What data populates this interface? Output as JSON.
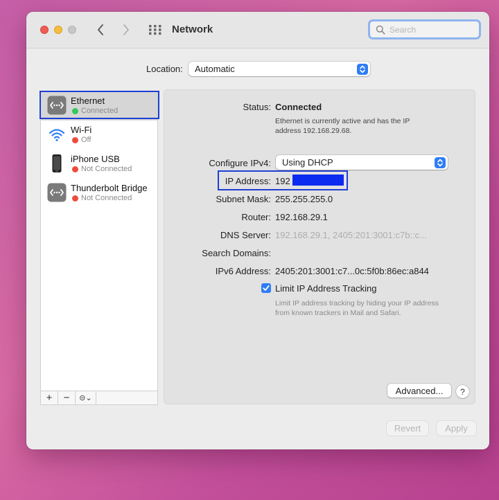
{
  "window": {
    "title": "Network"
  },
  "search": {
    "placeholder": "Search",
    "value": ""
  },
  "location": {
    "label": "Location:",
    "value": "Automatic"
  },
  "services": [
    {
      "name": "Ethernet",
      "status": "Connected",
      "status_color": "#34c759",
      "icon": "ethernet-icon",
      "selected": true
    },
    {
      "name": "Wi-Fi",
      "status": "Off",
      "status_color": "#ee4b3e",
      "icon": "wifi-icon",
      "selected": false
    },
    {
      "name": "iPhone USB",
      "status": "Not Connected",
      "status_color": "#ee4b3e",
      "icon": "iphone-icon",
      "selected": false
    },
    {
      "name": "Thunderbolt Bridge",
      "status": "Not Connected",
      "status_color": "#ee4b3e",
      "icon": "thunderbolt-bridge-icon",
      "selected": false
    }
  ],
  "sidebar_toolbar": {
    "add": "+",
    "remove": "−",
    "action": "⊝⌄"
  },
  "detail": {
    "status_label": "Status:",
    "status_value": "Connected",
    "status_desc_line1": "Ethernet is currently active and has the IP",
    "status_desc_line2": "address 192.168.29.68.",
    "configure_label": "Configure IPv4:",
    "configure_value": "Using DHCP",
    "ip_label": "IP Address:",
    "ip_value": "192",
    "subnet_label": "Subnet Mask:",
    "subnet_value": "255.255.255.0",
    "router_label": "Router:",
    "router_value": "192.168.29.1",
    "dns_label": "DNS Server:",
    "dns_value": "192.168.29.1, 2405:201:3001:c7b::c...",
    "search_domains_label": "Search Domains:",
    "ipv6_label": "IPv6 Address:",
    "ipv6_value": "2405:201:3001:c7...0c:5f0b:86ec:a844",
    "limit_tracking_label": "Limit IP Address Tracking",
    "limit_tracking_checked": true,
    "limit_desc_line1": "Limit IP address tracking by hiding your IP address",
    "limit_desc_line2": "from known trackers in Mail and Safari."
  },
  "buttons": {
    "advanced": "Advanced...",
    "help": "?",
    "revert": "Revert",
    "apply": "Apply"
  },
  "colors": {
    "accent": "#2f7df6",
    "highlight_box": "#1f3fd6",
    "redaction": "#0b2bf0"
  }
}
